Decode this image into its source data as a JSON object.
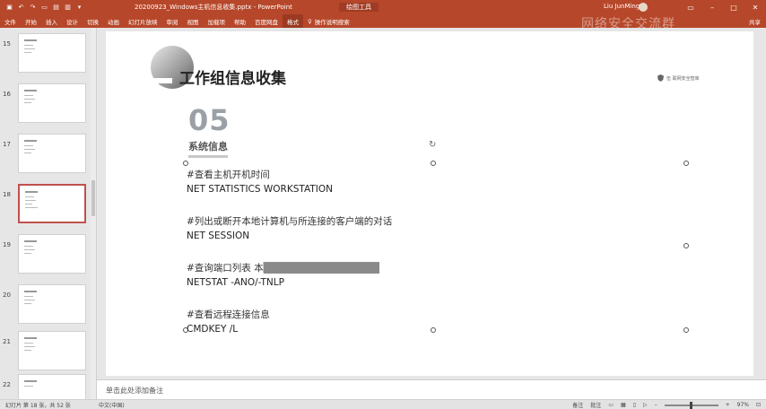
{
  "titlebar": {
    "doc_title": "20200923_Windows主机信息收集.pptx - PowerPoint",
    "tools_label": "绘图工具",
    "user_name": "Liu JunMing",
    "watermark": "网络安全交流群"
  },
  "tabs": [
    {
      "label": "文件"
    },
    {
      "label": "开始"
    },
    {
      "label": "插入"
    },
    {
      "label": "设计"
    },
    {
      "label": "切换"
    },
    {
      "label": "动画"
    },
    {
      "label": "幻灯片放映"
    },
    {
      "label": "审阅"
    },
    {
      "label": "视图"
    },
    {
      "label": "加载项"
    },
    {
      "label": "帮助"
    },
    {
      "label": "百度网盘"
    },
    {
      "label": "格式"
    }
  ],
  "search_label": "操作说明搜索",
  "share_label": "共享",
  "thumbnails": [
    {
      "num": "15"
    },
    {
      "num": "16"
    },
    {
      "num": "17"
    },
    {
      "num": "18"
    },
    {
      "num": "19"
    },
    {
      "num": "20"
    },
    {
      "num": "21"
    },
    {
      "num": "22"
    }
  ],
  "slide": {
    "title": "工作组信息收集",
    "logo_text": "伍 联网安全智库",
    "section_number": "05",
    "section_name": "系统信息",
    "lines": [
      {
        "text": "#查看主机开机时间",
        "type": "comment"
      },
      {
        "text": "NET STATISTICS WORKSTATION",
        "type": "cmd"
      },
      {
        "text": "#列出或断开本地计算机与所连接的客户端的对话",
        "type": "comment"
      },
      {
        "text": "NET SESSION",
        "type": "cmd"
      },
      {
        "text": "#查询端口列表 本",
        "type": "comment"
      },
      {
        "text": "NETSTAT -ANO/-TNLP",
        "type": "cmd"
      },
      {
        "text": "#查看远程连接信息",
        "type": "comment"
      },
      {
        "text": "CMDKEY /L",
        "type": "cmd"
      }
    ]
  },
  "notes_placeholder": "单击此处添加备注",
  "status": {
    "slide_info": "幻灯片 第 18 张，共 52 张",
    "language": "中文(中国)",
    "notes_btn": "备注",
    "comments_btn": "批注",
    "zoom": "97%"
  }
}
